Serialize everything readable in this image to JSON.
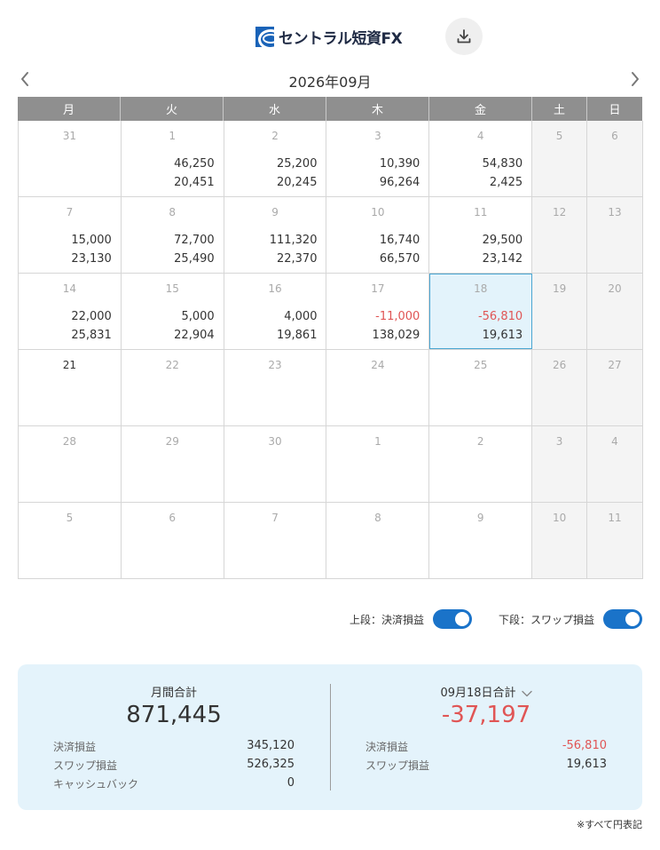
{
  "header": {
    "logo_text": "セントラル短資FX",
    "download_icon": "download-icon"
  },
  "month_nav": {
    "title": "2026年09月",
    "prev_icon": "chevron-left-icon",
    "next_icon": "chevron-right-icon"
  },
  "calendar": {
    "weekdays": [
      "月",
      "火",
      "水",
      "木",
      "金",
      "土",
      "日"
    ],
    "weeks": [
      [
        {
          "day": "31",
          "v1": "",
          "v2": ""
        },
        {
          "day": "1",
          "v1": "46,250",
          "v2": "20,451"
        },
        {
          "day": "2",
          "v1": "25,200",
          "v2": "20,245"
        },
        {
          "day": "3",
          "v1": "10,390",
          "v2": "96,264"
        },
        {
          "day": "4",
          "v1": "54,830",
          "v2": "2,425"
        },
        {
          "day": "5",
          "v1": "",
          "v2": ""
        },
        {
          "day": "6",
          "v1": "",
          "v2": ""
        }
      ],
      [
        {
          "day": "7",
          "v1": "15,000",
          "v2": "23,130"
        },
        {
          "day": "8",
          "v1": "72,700",
          "v2": "25,490"
        },
        {
          "day": "9",
          "v1": "111,320",
          "v2": "22,370"
        },
        {
          "day": "10",
          "v1": "16,740",
          "v2": "66,570"
        },
        {
          "day": "11",
          "v1": "29,500",
          "v2": "23,142"
        },
        {
          "day": "12",
          "v1": "",
          "v2": ""
        },
        {
          "day": "13",
          "v1": "",
          "v2": ""
        }
      ],
      [
        {
          "day": "14",
          "v1": "22,000",
          "v2": "25,831"
        },
        {
          "day": "15",
          "v1": "5,000",
          "v2": "22,904"
        },
        {
          "day": "16",
          "v1": "4,000",
          "v2": "19,861"
        },
        {
          "day": "17",
          "v1": "-11,000",
          "v2": "138,029"
        },
        {
          "day": "18",
          "v1": "-56,810",
          "v2": "19,613"
        },
        {
          "day": "19",
          "v1": "",
          "v2": ""
        },
        {
          "day": "20",
          "v1": "",
          "v2": ""
        }
      ],
      [
        {
          "day": "21",
          "v1": "",
          "v2": ""
        },
        {
          "day": "22",
          "v1": "",
          "v2": ""
        },
        {
          "day": "23",
          "v1": "",
          "v2": ""
        },
        {
          "day": "24",
          "v1": "",
          "v2": ""
        },
        {
          "day": "25",
          "v1": "",
          "v2": ""
        },
        {
          "day": "26",
          "v1": "",
          "v2": ""
        },
        {
          "day": "27",
          "v1": "",
          "v2": ""
        }
      ],
      [
        {
          "day": "28",
          "v1": "",
          "v2": ""
        },
        {
          "day": "29",
          "v1": "",
          "v2": ""
        },
        {
          "day": "30",
          "v1": "",
          "v2": ""
        },
        {
          "day": "1",
          "v1": "",
          "v2": ""
        },
        {
          "day": "2",
          "v1": "",
          "v2": ""
        },
        {
          "day": "3",
          "v1": "",
          "v2": ""
        },
        {
          "day": "4",
          "v1": "",
          "v2": ""
        }
      ],
      [
        {
          "day": "5",
          "v1": "",
          "v2": ""
        },
        {
          "day": "6",
          "v1": "",
          "v2": ""
        },
        {
          "day": "7",
          "v1": "",
          "v2": ""
        },
        {
          "day": "8",
          "v1": "",
          "v2": ""
        },
        {
          "day": "9",
          "v1": "",
          "v2": ""
        },
        {
          "day": "10",
          "v1": "",
          "v2": ""
        },
        {
          "day": "11",
          "v1": "",
          "v2": ""
        }
      ]
    ],
    "selected_day": "18",
    "today": "21"
  },
  "toggles": {
    "upper_label": "上段：決済損益",
    "upper_on": true,
    "lower_label": "下段：スワップ損益",
    "lower_on": true
  },
  "summary": {
    "month": {
      "title": "月間合計",
      "total": "871,445",
      "rows": [
        {
          "label": "決済損益",
          "value": "345,120"
        },
        {
          "label": "スワップ損益",
          "value": "526,325"
        },
        {
          "label": "キャッシュバック",
          "value": "0"
        }
      ]
    },
    "day": {
      "title": "09月18日合計",
      "total": "-37,197",
      "rows": [
        {
          "label": "決済損益",
          "value": "-56,810"
        },
        {
          "label": "スワップ損益",
          "value": "19,613"
        }
      ]
    }
  },
  "note": "※すべて円表記",
  "colors": {
    "accent": "#1a73c9",
    "negative": "#e05555",
    "header_bg": "#8f8f8f",
    "selected_bg": "#e3f3fb",
    "summary_bg": "#e4f3fb"
  }
}
